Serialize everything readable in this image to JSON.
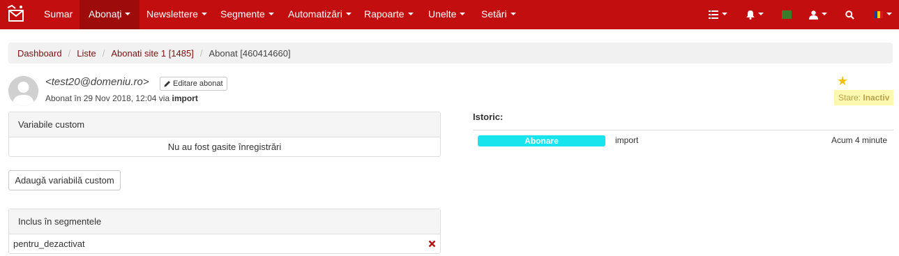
{
  "nav": {
    "items": [
      {
        "label": "Sumar",
        "dropdown": false
      },
      {
        "label": "Abonați",
        "dropdown": true,
        "active": true
      },
      {
        "label": "Newslettere",
        "dropdown": true
      },
      {
        "label": "Segmente",
        "dropdown": true
      },
      {
        "label": "Automatizări",
        "dropdown": true
      },
      {
        "label": "Rapoarte",
        "dropdown": true
      },
      {
        "label": "Unelte",
        "dropdown": true
      },
      {
        "label": "Setări",
        "dropdown": true
      }
    ],
    "right_icons": [
      "list-icon",
      "bell-icon",
      "flag-icon",
      "user-icon",
      "search-icon",
      "language-flag-icon"
    ],
    "bg_color": "#c20e0e"
  },
  "breadcrumb": {
    "items": [
      "Dashboard",
      "Liste",
      "Abonati site 1 [1485]"
    ],
    "current": "Abonat [460414660]"
  },
  "subscriber": {
    "email": "<test20@domeniu.ro>",
    "edit_label": "Editare abonat",
    "subscribed_prefix": "Abonat în 29 Nov 2018, 12:04 via",
    "subscribed_via": "import",
    "status_label": "Stare:",
    "status_value": "Inactiv"
  },
  "custom_vars": {
    "title": "Variabile custom",
    "empty_text": "Nu au fost gasite înregistrări",
    "add_label": "Adaugă variabilă custom"
  },
  "segments": {
    "title": "Inclus în segmentele",
    "items": [
      "pentru_dezactivat"
    ]
  },
  "history": {
    "title": "Istoric:",
    "events": [
      {
        "type": "Abonare",
        "source": "import",
        "time": "Acum 4 minute",
        "color": "#17e4ec"
      }
    ]
  }
}
